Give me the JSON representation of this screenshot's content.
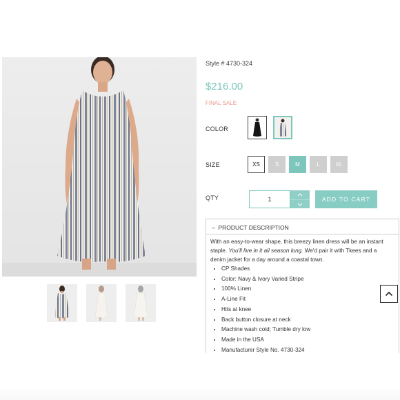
{
  "product": {
    "style_number": "Style # 4730-324",
    "price": "$216.00",
    "sale_note": "FINAL SALE"
  },
  "options": {
    "color_label": "COLOR",
    "colors": [
      "Black",
      "Navy & Ivory Varied Stripe"
    ],
    "selected_color": "Navy & Ivory Varied Stripe",
    "size_label": "SIZE",
    "sizes": [
      "XS",
      "S",
      "M",
      "L",
      "XL"
    ],
    "selected_size": "M",
    "qty_label": "QTY",
    "qty_value": "1",
    "add_to_cart": "ADD TO CART"
  },
  "description": {
    "header": "PRODUCT DESCRIPTION",
    "toggle_symbol": "–",
    "intro_1": "With an easy-to-wear shape, this breezy linen dress will be an instant staple. ",
    "intro_italic": "You'll live in it all season long.",
    "intro_2": " We'd pair it with Tkees and a denim jacket for a day around a coastal town.",
    "bullets": [
      "CP Shades",
      "Color: Navy & Ivory Varied Stripe",
      "100% Linen",
      "A-Line Fit",
      "Hits at knee",
      "Back button closure at neck",
      "Machine wash cold; Tumble dry low",
      "Made in the USA",
      "Manufacturer Style No. 4730-324"
    ]
  },
  "colors": {
    "accent": "#7cc6bd",
    "sale": "#e99a8f",
    "disabled_size": "#cfcfcf"
  },
  "icons": {
    "scroll_top": "chevron-up-icon",
    "qty_up": "chevron-up-icon",
    "qty_down": "chevron-down-icon"
  }
}
